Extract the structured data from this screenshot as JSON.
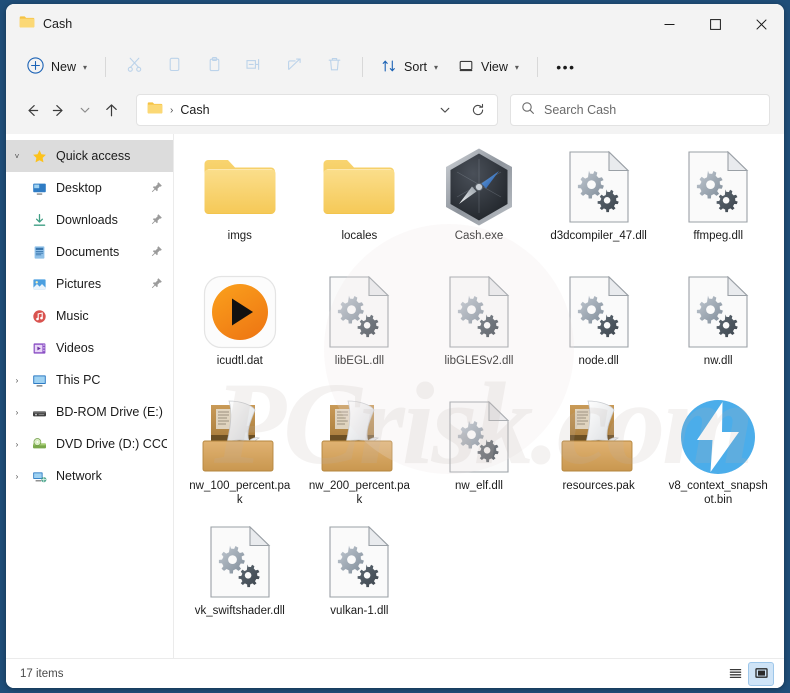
{
  "window": {
    "title": "Cash",
    "title_icon": "folder-icon",
    "controls": {
      "minimize": "—",
      "maximize": "□",
      "close": "✕"
    }
  },
  "command_bar": {
    "new_label": "New",
    "new_icon": "plus-circle-icon",
    "icon_buttons": [
      {
        "name": "cut-button",
        "icon": "scissors-icon"
      },
      {
        "name": "copy-button",
        "icon": "copy-icon"
      },
      {
        "name": "paste-button",
        "icon": "clipboard-icon"
      },
      {
        "name": "rename-button",
        "icon": "rename-icon"
      },
      {
        "name": "share-button",
        "icon": "share-icon"
      },
      {
        "name": "delete-button",
        "icon": "trash-icon"
      }
    ],
    "sort_label": "Sort",
    "sort_icon": "sort-arrows-icon",
    "view_label": "View",
    "view_icon": "monitor-icon",
    "more_label": "•••"
  },
  "address_bar": {
    "back_icon": "arrow-left-icon",
    "forward_icon": "arrow-right-icon",
    "recent_icon": "chevron-down-icon",
    "up_icon": "arrow-up-icon",
    "breadcrumb_icon": "folder-icon",
    "breadcrumb_separator": "›",
    "breadcrumb_text": "Cash",
    "dropdown_icon": "chevron-down-icon",
    "refresh_icon": "refresh-icon"
  },
  "search": {
    "placeholder": "Search Cash",
    "icon": "search-icon"
  },
  "sidebar": {
    "items": [
      {
        "label": "Quick access",
        "icon": "star-icon",
        "expand": "˅",
        "selected": true,
        "child": false,
        "pinned": false
      },
      {
        "label": "Desktop",
        "icon": "desktop-icon",
        "expand": "",
        "selected": false,
        "child": true,
        "pinned": true
      },
      {
        "label": "Downloads",
        "icon": "downloads-icon",
        "expand": "",
        "selected": false,
        "child": true,
        "pinned": true
      },
      {
        "label": "Documents",
        "icon": "documents-icon",
        "expand": "",
        "selected": false,
        "child": true,
        "pinned": true
      },
      {
        "label": "Pictures",
        "icon": "pictures-icon",
        "expand": "",
        "selected": false,
        "child": true,
        "pinned": true
      },
      {
        "label": "Music",
        "icon": "music-icon",
        "expand": "",
        "selected": false,
        "child": true,
        "pinned": false
      },
      {
        "label": "Videos",
        "icon": "videos-icon",
        "expand": "",
        "selected": false,
        "child": true,
        "pinned": false
      },
      {
        "label": "This PC",
        "icon": "this-pc-icon",
        "expand": "›",
        "selected": false,
        "child": false,
        "pinned": false
      },
      {
        "label": "BD-ROM Drive (E:) C",
        "icon": "optical-drive-icon",
        "expand": "›",
        "selected": false,
        "child": false,
        "pinned": false
      },
      {
        "label": "DVD Drive (D:) CCCC",
        "icon": "dvd-drive-icon",
        "expand": "›",
        "selected": false,
        "child": false,
        "pinned": false
      },
      {
        "label": "Network",
        "icon": "network-icon",
        "expand": "›",
        "selected": false,
        "child": false,
        "pinned": false
      }
    ]
  },
  "files": [
    {
      "name": "imgs",
      "icon": "folder-icon"
    },
    {
      "name": "locales",
      "icon": "folder-icon"
    },
    {
      "name": "Cash.exe",
      "icon": "compass-hexagon-icon"
    },
    {
      "name": "d3dcompiler_47.dll",
      "icon": "dll-gears-icon"
    },
    {
      "name": "ffmpeg.dll",
      "icon": "dll-gears-icon"
    },
    {
      "name": "icudtl.dat",
      "icon": "media-play-icon"
    },
    {
      "name": "libEGL.dll",
      "icon": "dll-gears-icon"
    },
    {
      "name": "libGLESv2.dll",
      "icon": "dll-gears-icon"
    },
    {
      "name": "node.dll",
      "icon": "dll-gears-icon"
    },
    {
      "name": "nw.dll",
      "icon": "dll-gears-icon"
    },
    {
      "name": "nw_100_percent.pak",
      "icon": "archive-box-icon"
    },
    {
      "name": "nw_200_percent.pak",
      "icon": "archive-box-icon"
    },
    {
      "name": "nw_elf.dll",
      "icon": "dll-gears-icon"
    },
    {
      "name": "resources.pak",
      "icon": "archive-box-icon"
    },
    {
      "name": "v8_context_snapshot.bin",
      "icon": "blue-bolt-icon"
    },
    {
      "name": "vk_swiftshader.dll",
      "icon": "dll-gears-icon"
    },
    {
      "name": "vulkan-1.dll",
      "icon": "dll-gears-icon"
    }
  ],
  "status_bar": {
    "item_count": "17 items",
    "list_view_icon": "list-view-icon",
    "icons_view_icon": "large-icons-view-icon"
  },
  "watermark": {
    "text": "PCrisk.com"
  },
  "colors": {
    "desktop_background": "#1f4e79",
    "chrome_background": "#f3f3f3",
    "content_background": "#ffffff",
    "selection": "#dcdcdc",
    "folder_yellow": "#f7cd5f",
    "accent_blue": "#4ba8e8",
    "media_orange": "#f28b1e"
  }
}
